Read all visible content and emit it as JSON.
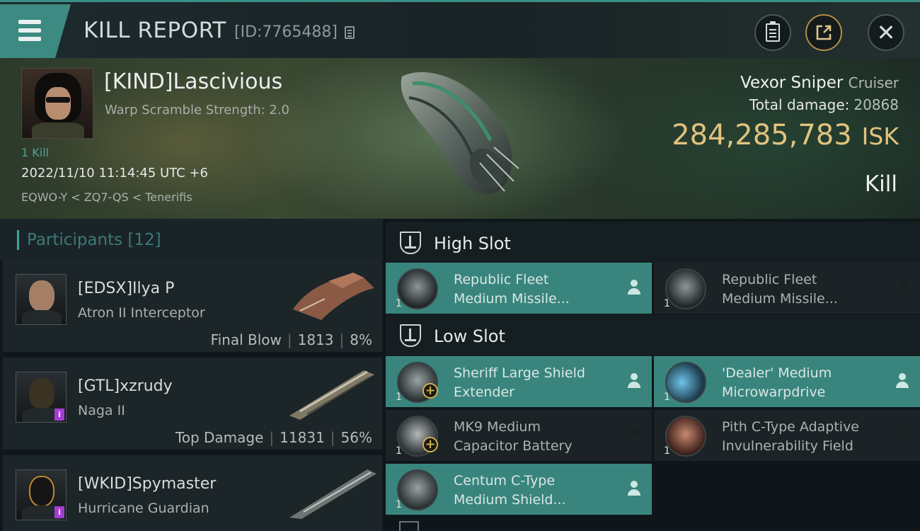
{
  "header": {
    "title": "KILL REPORT",
    "report_id": "[ID:7765488]",
    "icons": [
      "menu-icon",
      "copy-icon",
      "clipboard-icon",
      "share-icon",
      "close-icon"
    ]
  },
  "victim": {
    "pilot": "[KIND]Lascivious",
    "warp_scramble": "Warp Scramble Strength: 2.0",
    "kill_count": "1 Kill",
    "timestamp": "2022/11/10 11:14:45 UTC +6",
    "location": "EQWO-Y < ZQ7-QS < Tenerifis",
    "ship_name": "Vexor Sniper",
    "ship_class": "Cruiser",
    "total_damage_label": "Total damage:",
    "total_damage": "20868",
    "isk_value": "284,285,783",
    "isk_unit": "ISK",
    "result": "Kill"
  },
  "participants": {
    "title": "Participants",
    "count": "[12]",
    "items": [
      {
        "name": "[EDSX]Ilya P",
        "ship": "Atron II Interceptor",
        "role": "Final Blow",
        "damage": "1813",
        "percent": "8%"
      },
      {
        "name": "[GTL]xzrudy",
        "ship": "Naga II",
        "role": "Top Damage",
        "damage": "11831",
        "percent": "56%"
      },
      {
        "name": "[WKID]Spymaster",
        "ship": "Hurricane Guardian"
      }
    ]
  },
  "fitting": {
    "high_slot": {
      "title": "High Slot",
      "modules": [
        {
          "line1": "Republic Fleet",
          "line2": "Medium Missile...",
          "qty": "1"
        },
        {
          "line1": "Republic Fleet",
          "line2": "Medium Missile...",
          "qty": "1"
        }
      ]
    },
    "low_slot": {
      "title": "Low Slot",
      "modules": [
        {
          "line1": "Sheriff Large Shield",
          "line2": "Extender",
          "qty": "1"
        },
        {
          "line1": "'Dealer' Medium",
          "line2": "Microwarpdrive",
          "qty": "1"
        },
        {
          "line1": "MK9 Medium",
          "line2": "Capacitor Battery",
          "qty": "1"
        },
        {
          "line1": "Pith C-Type Adaptive",
          "line2": "Invulnerability Field",
          "qty": "1"
        },
        {
          "line1": "Centum C-Type",
          "line2": "Medium Shield...",
          "qty": "1"
        }
      ]
    }
  },
  "colors": {
    "accent": "#3ca59a",
    "module_active": "#39857d",
    "isk_gold": "#e1c27d",
    "badge_purple": "#a43dd2"
  }
}
